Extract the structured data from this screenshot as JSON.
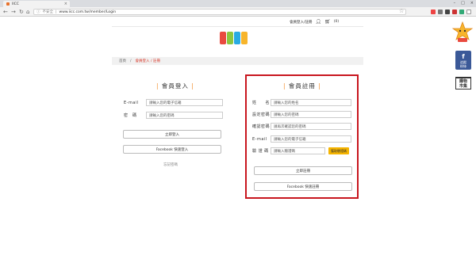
{
  "browser": {
    "tab_title": "IICC",
    "security_label": "不安全",
    "url": "www.iicc.com.tw/member/Login"
  },
  "topnav": {
    "login_register": "會員登入/註冊",
    "cart_count": "(0)"
  },
  "breadcrumb": {
    "home": "首頁",
    "sep": "/",
    "current": "會員登入 / 註冊"
  },
  "login": {
    "title": "會員登入",
    "email_label": "E-mail",
    "email_placeholder": "請輸入您的電子信箱",
    "password_label": "密　碼",
    "password_placeholder": "請輸入您的密碼",
    "login_button": "立即登入",
    "facebook_button": "Facebook 快速登入",
    "forgot_link": "忘記密碼"
  },
  "register": {
    "title": "會員註冊",
    "name_label": "姓　　名",
    "name_placeholder": "請輸入您的姓名",
    "password_label": "設定密碼",
    "password_placeholder": "請輸入您的密碼",
    "confirm_label": "確認密碼",
    "confirm_placeholder": "請再次確認您的密碼",
    "email_label": "E-mail",
    "email_placeholder": "請輸入您的電子信箱",
    "code_label": "驗 證 碼",
    "code_placeholder": "請輸入驗證碼",
    "code_button": "獲取驗證碼",
    "register_button": "立即註冊",
    "facebook_button": "Facebook 快速註冊"
  },
  "sidebar": {
    "fb_line1": "f",
    "fb_line2": "追蹤",
    "fb_line3": "粉絲",
    "market_line1": "購物",
    "market_line2": "市集"
  },
  "colors": {
    "accent": "#f28c28",
    "highlight_box": "#c8161e",
    "code_button": "#f5b400",
    "breadcrumb_current": "#d9392a"
  }
}
